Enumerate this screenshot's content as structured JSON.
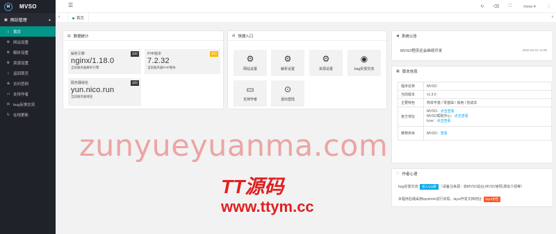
{
  "app": {
    "logo_text": "MVSO",
    "logo_mark": "M"
  },
  "topbar": {
    "user": "mvso ▾"
  },
  "sidebar": {
    "group_label": "网站管理",
    "items": [
      {
        "label": "首页",
        "icon": "home-icon",
        "glyph": "⌂",
        "active": true
      },
      {
        "label": "网站设置",
        "icon": "gear-icon",
        "glyph": "⚙",
        "active": false
      },
      {
        "label": "解析设置",
        "icon": "gear-icon",
        "glyph": "⚙",
        "active": false
      },
      {
        "label": "资源设置",
        "icon": "gear-icon",
        "glyph": "⚙",
        "active": false
      },
      {
        "label": "返回首页",
        "icon": "home-icon",
        "glyph": "⌂",
        "active": false
      },
      {
        "label": "访问官网",
        "icon": "link-icon",
        "glyph": "⊕",
        "active": false
      },
      {
        "label": "支持作者",
        "icon": "card-icon",
        "glyph": "▭",
        "active": false
      },
      {
        "label": "bug反馈交流",
        "icon": "chat-icon",
        "glyph": "✉",
        "active": false
      },
      {
        "label": "在线更新",
        "icon": "refresh-icon",
        "glyph": "↻",
        "active": false
      }
    ]
  },
  "tabs": {
    "home": "首页"
  },
  "stats": {
    "title": "数据统计",
    "cards": [
      {
        "label": "解析引擎",
        "value": "nginx/1.18.0",
        "sub": "当前服务器解析引擎",
        "badge": "实时",
        "badge_color": "#333333"
      },
      {
        "label": "PHP版本",
        "value": "7.2.32",
        "sub": "当前服务器PHP版本",
        "badge": "实时",
        "badge_color": "#ffb800"
      },
      {
        "label": "服务器域名",
        "value": "yun.nico.run",
        "sub": "当前服务器域名",
        "badge": "实时",
        "badge_color": "#333333"
      }
    ]
  },
  "shortcuts": {
    "title": "快捷入口",
    "items": [
      {
        "label": "网站设置",
        "icon": "gears-icon",
        "glyph": "⚙"
      },
      {
        "label": "解析设置",
        "icon": "gears-icon",
        "glyph": "⚙"
      },
      {
        "label": "资源设置",
        "icon": "gears-icon",
        "glyph": "⚙"
      },
      {
        "label": "bug反馈交流",
        "icon": "qq-penguin-icon",
        "glyph": "◉"
      },
      {
        "label": "支持作者",
        "icon": "card-icon",
        "glyph": "▭"
      },
      {
        "label": "退出登陆",
        "icon": "logout-icon",
        "glyph": "⊙"
      }
    ]
  },
  "notice": {
    "title": "系统公告",
    "text": "MVSO程序还会继续开发",
    "date": "2020-06-24 12:00"
  },
  "version": {
    "title": "版本信息",
    "rows": [
      {
        "key": "程序名称",
        "value": "MVSO"
      },
      {
        "key": "当前版本",
        "value": "v1.3.0"
      },
      {
        "key": "主要特色",
        "value": "简单丰富 / 零基础 / 易用 / 低成本"
      },
      {
        "key": "官方地址",
        "lines": [
          {
            "text": "MVSO：",
            "link": "点击查看"
          },
          {
            "text": "MVSO帮助中心：",
            "link": "点击查看"
          },
          {
            "text": "Icon：",
            "link": "点击查看"
          }
        ]
      },
      {
        "key": "推荐序目",
        "lines": [
          {
            "text": "MVSO：",
            "link": "查看"
          }
        ]
      }
    ]
  },
  "author": {
    "title": "作者心语",
    "line1_prefix": "bug反馈交流:",
    "qq_label": "加入QQ群",
    "qq_color": "#01aaed",
    "line1_suffix": "（请备注来源：如MVSO后台,MVSO官网,朋友介绍等）",
    "line2": "本程序后端采用layuimini进行实现。layui开发文档地址:",
    "doc_label": "layui文档",
    "doc_color": "#ff5722"
  },
  "watermark": {
    "main": "zunyueyuanma.com",
    "logo": "TT源码",
    "url": "www.ttym.cc"
  }
}
